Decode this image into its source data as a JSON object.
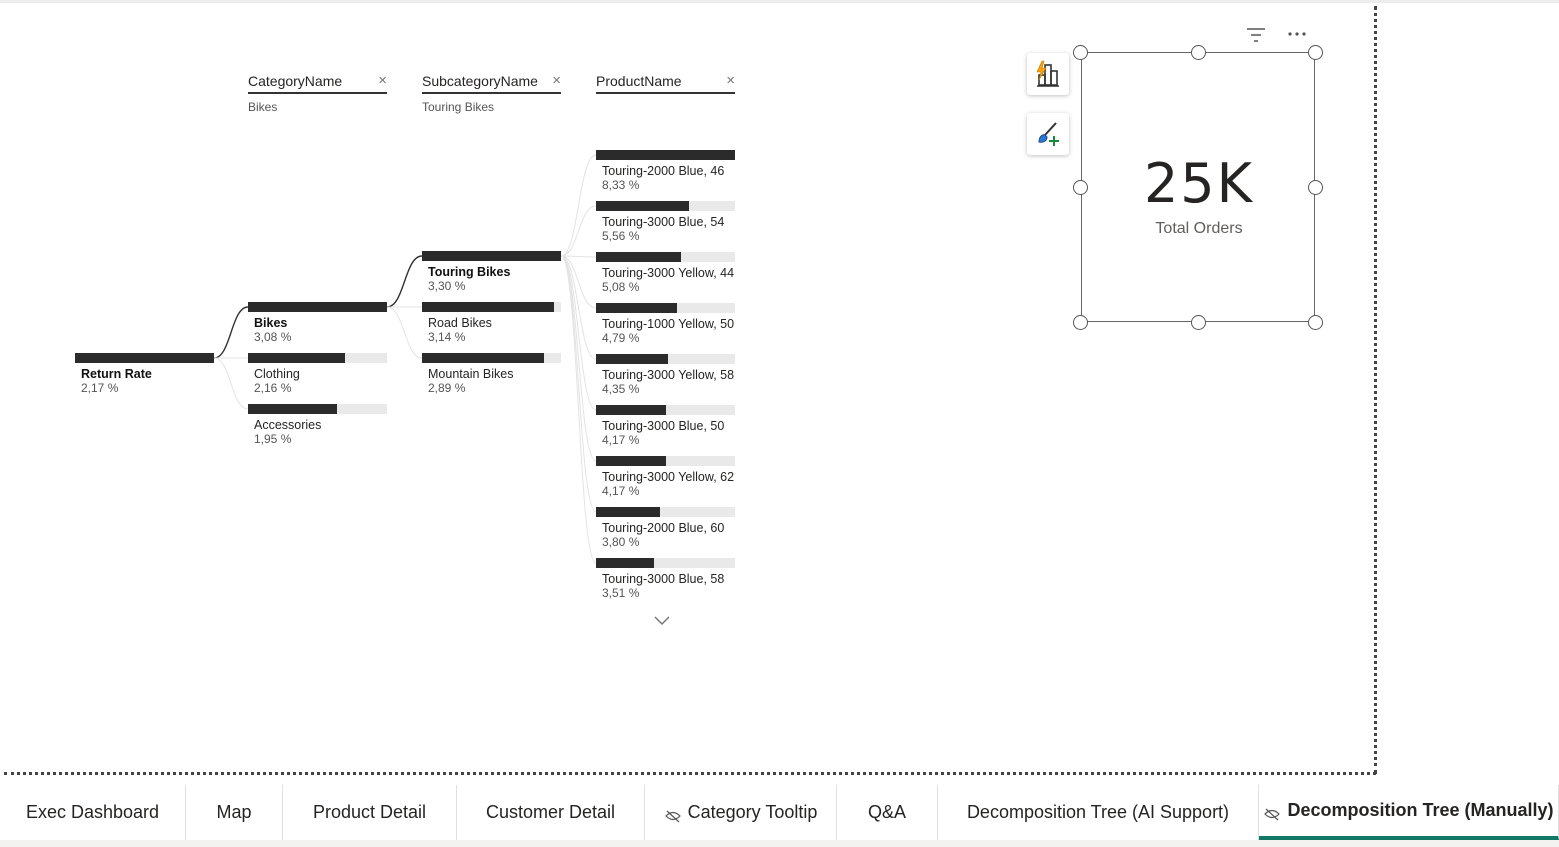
{
  "decomposition_tree": {
    "levels": [
      {
        "name": "CategoryName",
        "filter": "Bikes",
        "close": "×"
      },
      {
        "name": "SubcategoryName",
        "filter": "Touring Bikes",
        "close": "×"
      },
      {
        "name": "ProductName",
        "filter": "",
        "close": "×"
      }
    ],
    "root": {
      "label": "Return Rate",
      "value": "2,17 %",
      "fraction": 1.0
    },
    "categories": [
      {
        "label": "Bikes",
        "value": "3,08 %",
        "fraction": 1.0
      },
      {
        "label": "Clothing",
        "value": "2,16 %",
        "fraction": 0.7
      },
      {
        "label": "Accessories",
        "value": "1,95 %",
        "fraction": 0.64
      }
    ],
    "subcategories": [
      {
        "label": "Touring Bikes",
        "value": "3,30 %",
        "fraction": 1.0
      },
      {
        "label": "Road Bikes",
        "value": "3,14 %",
        "fraction": 0.95
      },
      {
        "label": "Mountain Bikes",
        "value": "2,89 %",
        "fraction": 0.88
      }
    ],
    "products": [
      {
        "label": "Touring-2000 Blue, 46",
        "value": "8,33 %",
        "fraction": 1.0
      },
      {
        "label": "Touring-3000 Blue, 54",
        "value": "5,56 %",
        "fraction": 0.67
      },
      {
        "label": "Touring-3000 Yellow, 44",
        "value": "5,08 %",
        "fraction": 0.61
      },
      {
        "label": "Touring-1000 Yellow, 50",
        "value": "4,79 %",
        "fraction": 0.58
      },
      {
        "label": "Touring-3000 Yellow, 58",
        "value": "4,35 %",
        "fraction": 0.52
      },
      {
        "label": "Touring-3000 Blue, 50",
        "value": "4,17 %",
        "fraction": 0.5
      },
      {
        "label": "Touring-3000 Yellow, 62",
        "value": "4,17 %",
        "fraction": 0.5
      },
      {
        "label": "Touring-2000 Blue, 60",
        "value": "3,80 %",
        "fraction": 0.46
      },
      {
        "label": "Touring-3000 Blue, 58",
        "value": "3,51 %",
        "fraction": 0.42
      }
    ]
  },
  "card": {
    "value": "25K",
    "label": "Total Orders"
  },
  "icons": {
    "filter": "filter-icon",
    "more": "more-options-icon",
    "build_visual": "build-visual-icon",
    "format_visual": "format-visual-icon",
    "expand": "chevron-down-icon",
    "hidden_page": "hidden-page-icon"
  },
  "tabs": [
    {
      "label": "Exec Dashboard",
      "hidden": false,
      "active": false
    },
    {
      "label": "Map",
      "hidden": false,
      "active": false
    },
    {
      "label": "Product Detail",
      "hidden": false,
      "active": false
    },
    {
      "label": "Customer Detail",
      "hidden": false,
      "active": false
    },
    {
      "label": "Category Tooltip",
      "hidden": true,
      "active": false
    },
    {
      "label": "Q&A",
      "hidden": false,
      "active": false
    },
    {
      "label": "Decomposition Tree (AI Support)",
      "hidden": false,
      "active": false
    },
    {
      "label": "Decomposition Tree (Manually)",
      "hidden": true,
      "active": true
    }
  ],
  "colors": {
    "bar": "#2b2b2b",
    "track": "#e9e9e9",
    "active_tab": "#117865"
  }
}
